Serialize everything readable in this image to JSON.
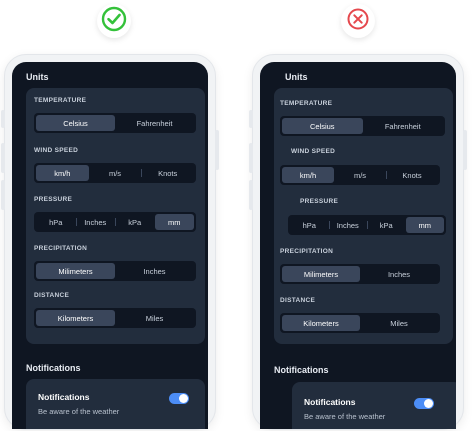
{
  "colors": {
    "good": "#34c13a",
    "bad": "#e5484d",
    "screen_bg": "#0f1622",
    "card_bg": "#222d3d",
    "selected_bg": "#3a465b",
    "toggle_on": "#4c8df6"
  },
  "icons": {
    "good": "check-circle-icon",
    "bad": "x-circle-icon"
  },
  "left": {
    "units_title": "Units",
    "temperature": {
      "label": "TEMPERATURE",
      "options": [
        "Celsius",
        "Fahrenheit"
      ],
      "selected": "Celsius"
    },
    "wind": {
      "label": "WIND SPEED",
      "options": [
        "km/h",
        "m/s",
        "Knots"
      ],
      "selected": "km/h"
    },
    "pressure": {
      "label": "PRESSURE",
      "options": [
        "hPa",
        "Inches",
        "kPa",
        "mm"
      ],
      "selected": "mm"
    },
    "precipitation": {
      "label": "PRECIPITATION",
      "options": [
        "Milimeters",
        "Inches"
      ],
      "selected": "Milimeters"
    },
    "distance": {
      "label": "DISTANCE",
      "options": [
        "Kilometers",
        "Miles"
      ],
      "selected": "Kilometers"
    },
    "notifications_title": "Notifications",
    "notif_item_title": "Notifications",
    "notif_item_sub": "Be aware of the weather"
  },
  "right": {
    "units_title": "Units",
    "temperature": {
      "label": "TEMPERATURE",
      "options": [
        "Celsius",
        "Fahrenheit"
      ],
      "selected": "Celsius"
    },
    "wind": {
      "label": "WIND SPEED",
      "options": [
        "km/h",
        "m/s",
        "Knots"
      ],
      "selected": "km/h"
    },
    "pressure": {
      "label": "PRESSURE",
      "options": [
        "hPa",
        "Inches",
        "kPa",
        "mm"
      ],
      "selected": "mm"
    },
    "precipitation": {
      "label": "PRECIPITATION",
      "options": [
        "Milimeters",
        "Inches"
      ],
      "selected": "Milimeters"
    },
    "distance": {
      "label": "DISTANCE",
      "options": [
        "Kilometers",
        "Miles"
      ],
      "selected": "Kilometers"
    },
    "notifications_title": "Notifications",
    "notif_item_title": "Notifications",
    "notif_item_sub": "Be aware of the weather"
  }
}
